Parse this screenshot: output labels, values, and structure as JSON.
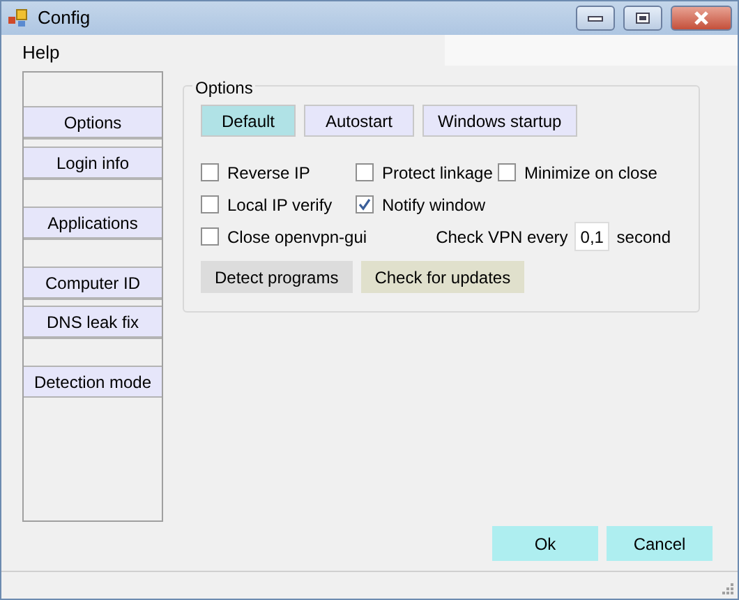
{
  "window": {
    "title": "Config"
  },
  "menu": [
    {
      "label": "Help"
    }
  ],
  "sidebar": {
    "items": [
      {
        "label": "Options"
      },
      {
        "label": "Login info"
      },
      {
        "label": "Applications"
      },
      {
        "label": "Computer ID"
      },
      {
        "label": "DNS leak fix"
      },
      {
        "label": "Detection mode"
      }
    ]
  },
  "options_group": {
    "title": "Options",
    "modes": [
      {
        "label": "Default",
        "selected": true
      },
      {
        "label": "Autostart",
        "selected": false
      },
      {
        "label": "Windows startup",
        "selected": false
      }
    ],
    "checkboxes": [
      {
        "label": "Reverse IP",
        "checked": false
      },
      {
        "label": "Protect linkage",
        "checked": false
      },
      {
        "label": "Minimize on close",
        "checked": false
      },
      {
        "label": "Local IP verify",
        "checked": false
      },
      {
        "label": "Notify window",
        "checked": true
      },
      {
        "label": "Close openvpn-gui",
        "checked": false
      }
    ],
    "check_interval": {
      "label": "Check VPN every",
      "value": "0,1",
      "unit": "second"
    },
    "actions": [
      {
        "label": "Detect programs",
        "kind": "grey"
      },
      {
        "label": "Check for updates",
        "kind": "olive"
      }
    ]
  },
  "buttons": [
    {
      "label": "Ok"
    },
    {
      "label": "Cancel"
    }
  ]
}
